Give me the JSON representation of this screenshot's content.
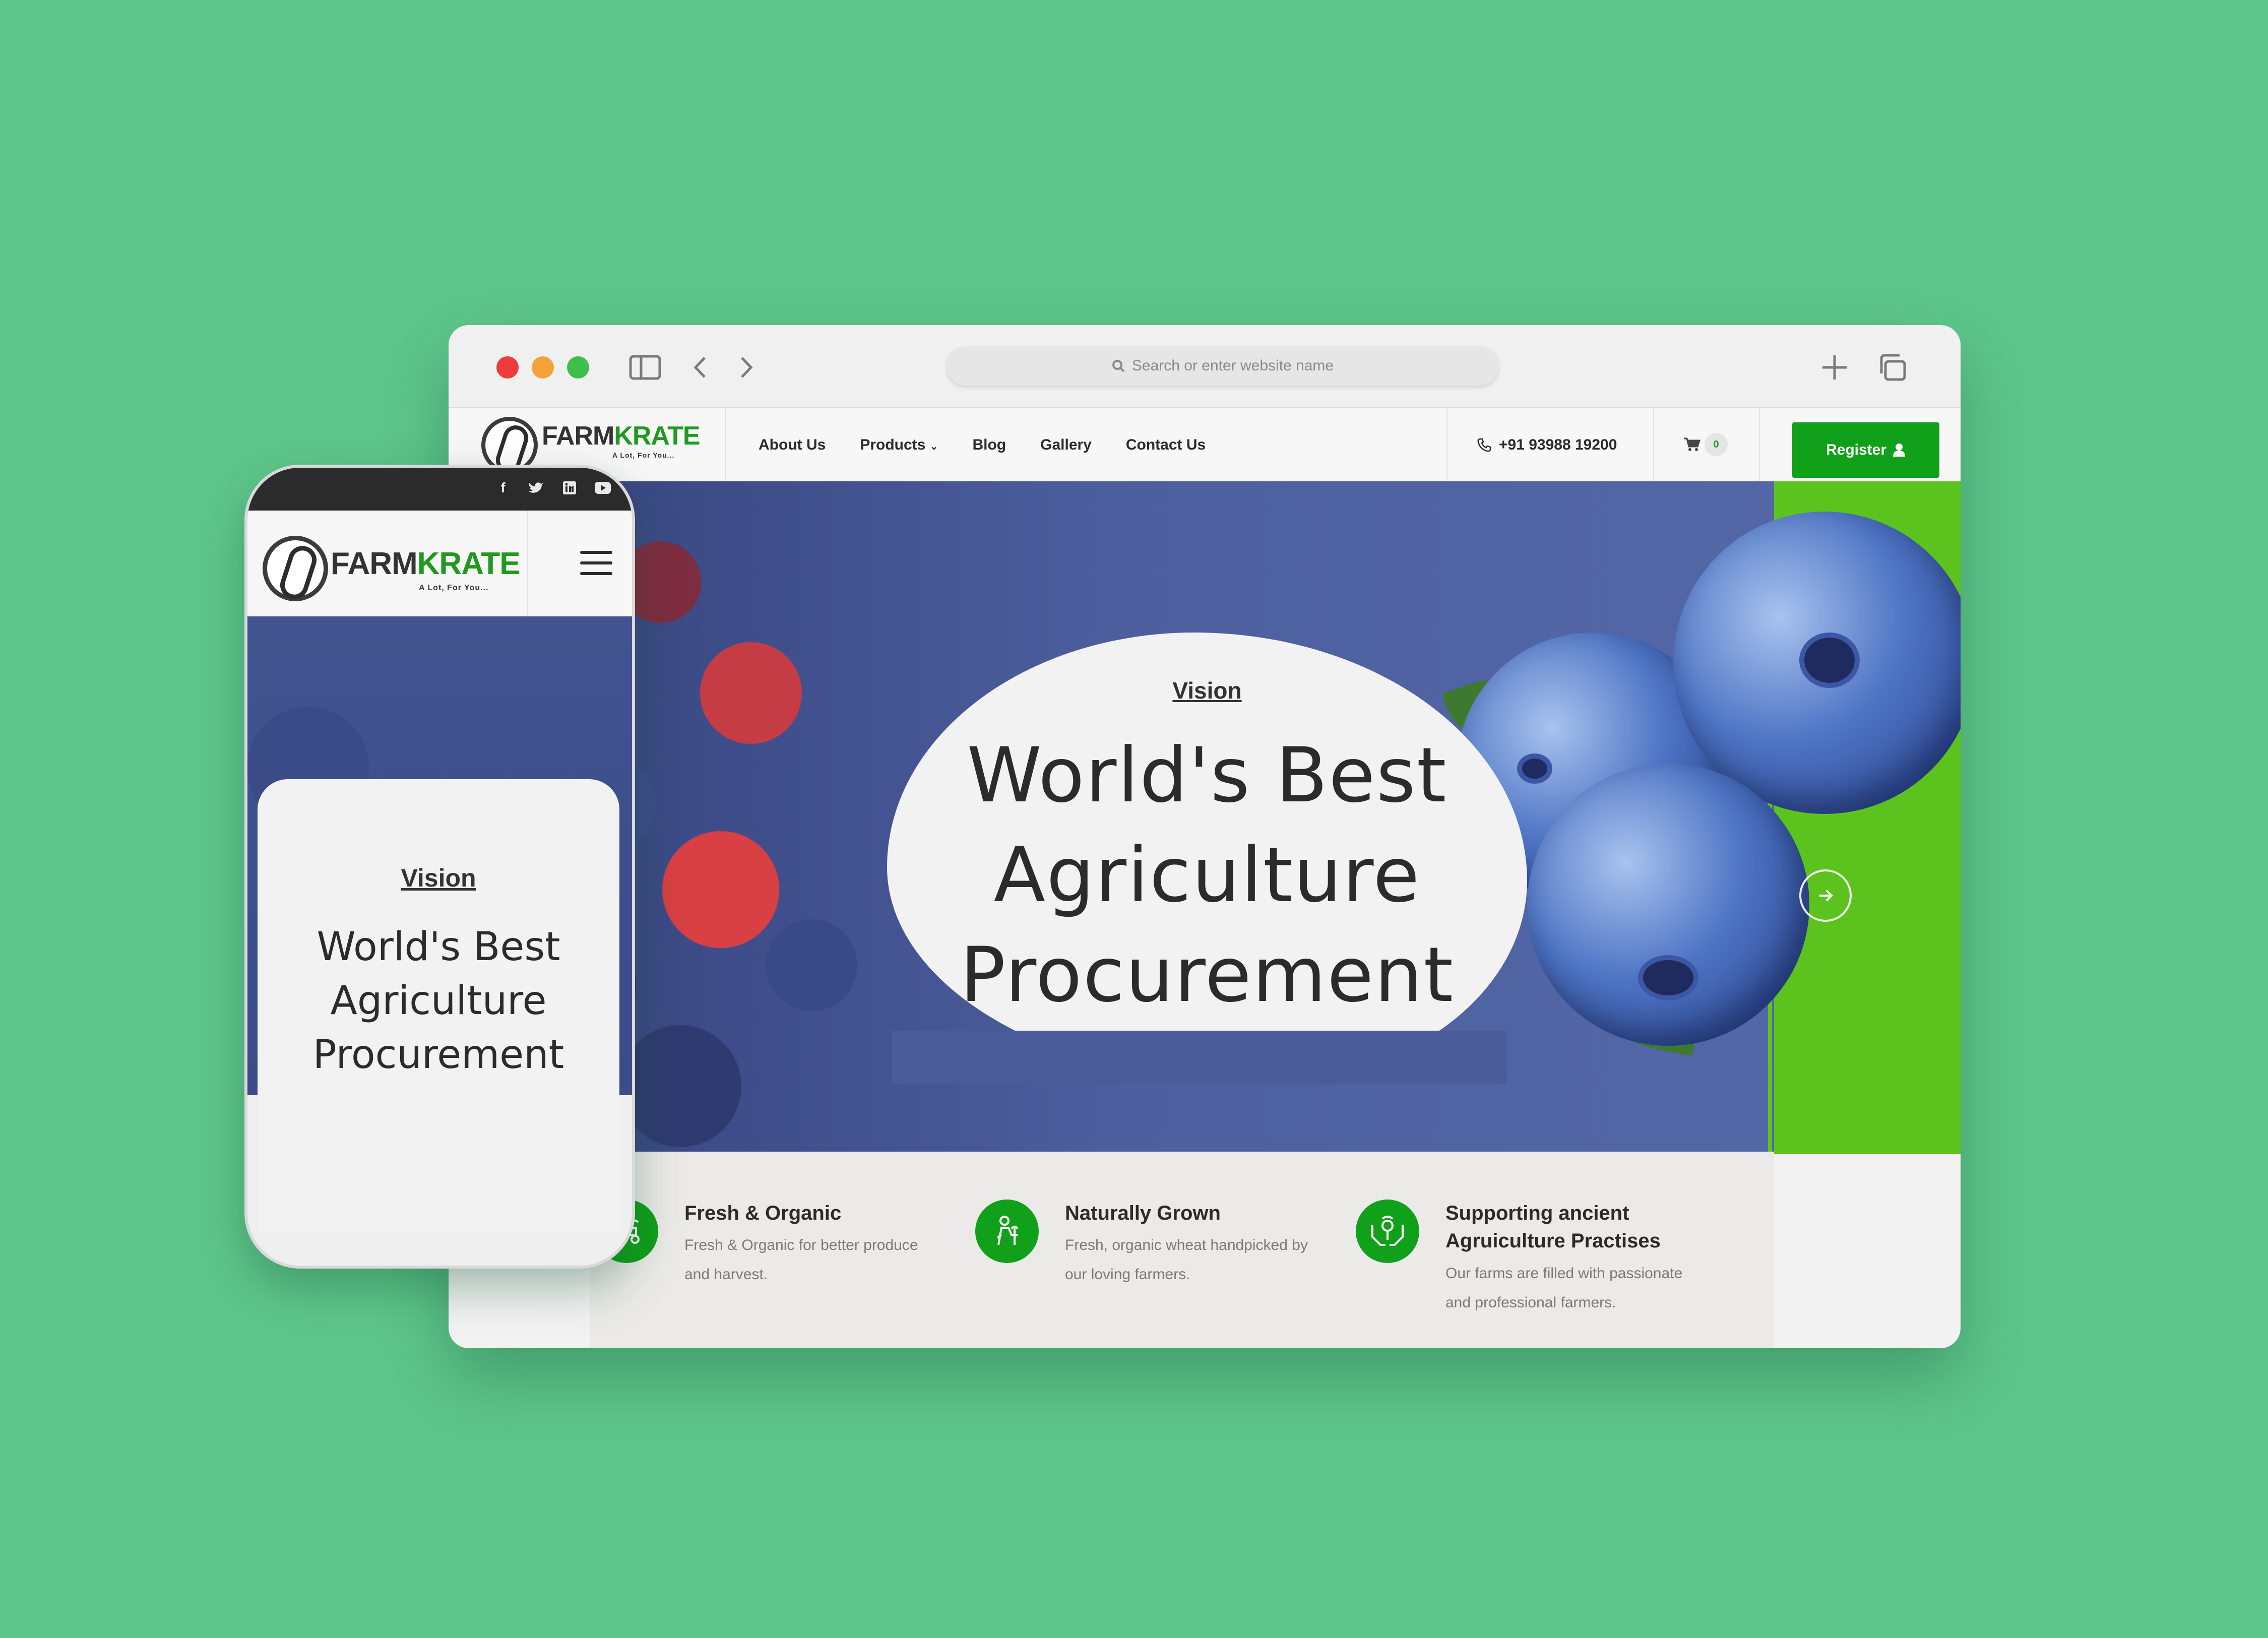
{
  "browser": {
    "address_placeholder": "Search or enter website name"
  },
  "site": {
    "logo": {
      "brand_farm": "FARM",
      "brand_krate": "KRATE",
      "tagline": "A Lot, For You..."
    },
    "nav": [
      "About Us",
      "Products",
      "Blog",
      "Gallery",
      "Contact Us"
    ],
    "phone": "+91 93988 19200",
    "cart_count": "0",
    "register_label": "Register"
  },
  "hero": {
    "label": "Vision",
    "title_lines": [
      "World's Best",
      "Agriculture",
      "Procurement"
    ]
  },
  "features": [
    {
      "title": "Fresh & Organic",
      "desc_lines": [
        "Fresh & Organic for better produce",
        "and harvest."
      ],
      "icon": "tractor-icon"
    },
    {
      "title": "Naturally Grown",
      "desc_lines": [
        "Fresh, organic wheat handpicked by",
        "our loving farmers."
      ],
      "icon": "farmer-icon"
    },
    {
      "title_lines": [
        "Supporting ancient",
        "Agruiculture Practises"
      ],
      "desc_lines": [
        "Our farms are filled with passionate",
        "and professional farmers."
      ],
      "icon": "hands-plant-icon"
    }
  ],
  "mobile": {
    "social": [
      "f",
      "t",
      "in",
      "yt"
    ],
    "label": "Vision",
    "title_lines": [
      "World's Best",
      "Agriculture",
      "Procurement"
    ]
  },
  "colors": {
    "background": "#5ec68b",
    "accent_green": "#10a01a",
    "lime": "#5cc31e"
  }
}
